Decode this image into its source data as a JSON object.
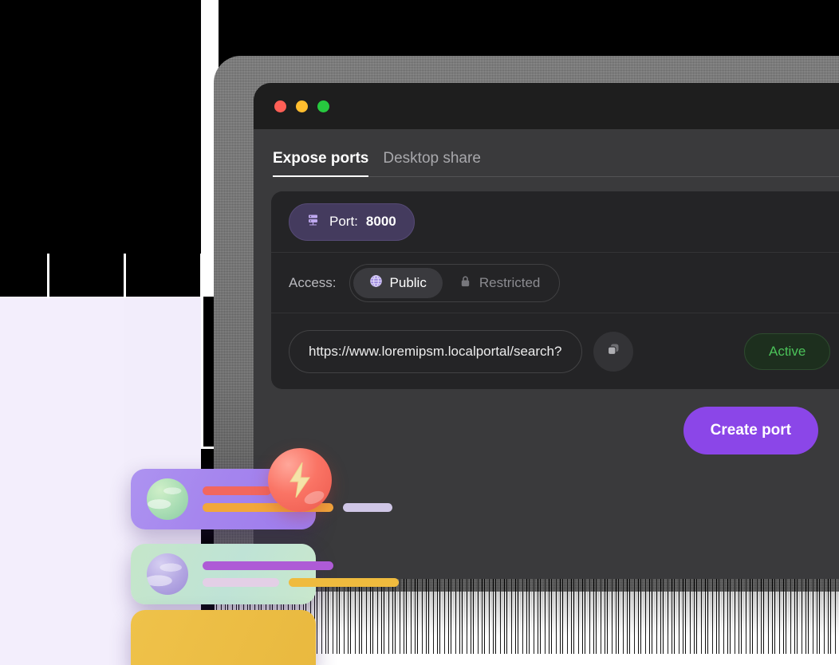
{
  "window": {
    "traffic_lights": [
      {
        "name": "close",
        "color": "#FF5F56"
      },
      {
        "name": "minimize",
        "color": "#FFBD2E"
      },
      {
        "name": "maximize",
        "color": "#27C93F"
      }
    ]
  },
  "tabs": [
    {
      "label": "Expose ports",
      "active": true
    },
    {
      "label": "Desktop share",
      "active": false
    }
  ],
  "port": {
    "icon": "server-icon",
    "prefix": "Port: ",
    "value": "8000",
    "badge_color": "#443B5E"
  },
  "access": {
    "label": "Access:",
    "options": [
      {
        "label": "Public",
        "icon": "globe-icon",
        "selected": true
      },
      {
        "label": "Restricted",
        "icon": "lock-icon",
        "selected": false
      }
    ]
  },
  "url_row": {
    "url": "https://www.loremipsm.localportal/search?",
    "copy_icon": "copy-icon",
    "status": "Active",
    "status_color": "#4BC259"
  },
  "actions": {
    "create_port_label": "Create port",
    "create_port_color": "#8B46E8"
  },
  "decor": {
    "cards": [
      {
        "name": "purple-card",
        "sphere": "green-sphere",
        "pills": [
          {
            "color": "#F2675F",
            "width": 86
          },
          {
            "color": "#F2A73B",
            "width": 164
          },
          {
            "color": "#CFC6E6",
            "width": 62
          }
        ]
      },
      {
        "name": "green-card",
        "sphere": "purple-sphere",
        "pills": [
          {
            "color": "#AE5BD6",
            "width": 164
          },
          {
            "color": "#E3CFE6",
            "width": 96
          },
          {
            "color": "#EFBB3E",
            "width": 138
          }
        ]
      },
      {
        "name": "yellow-card",
        "sphere": null,
        "pills": []
      }
    ],
    "bolt": {
      "name": "lightning-bolt-sphere",
      "color": "#FA7465",
      "glyph": "⚡"
    }
  }
}
